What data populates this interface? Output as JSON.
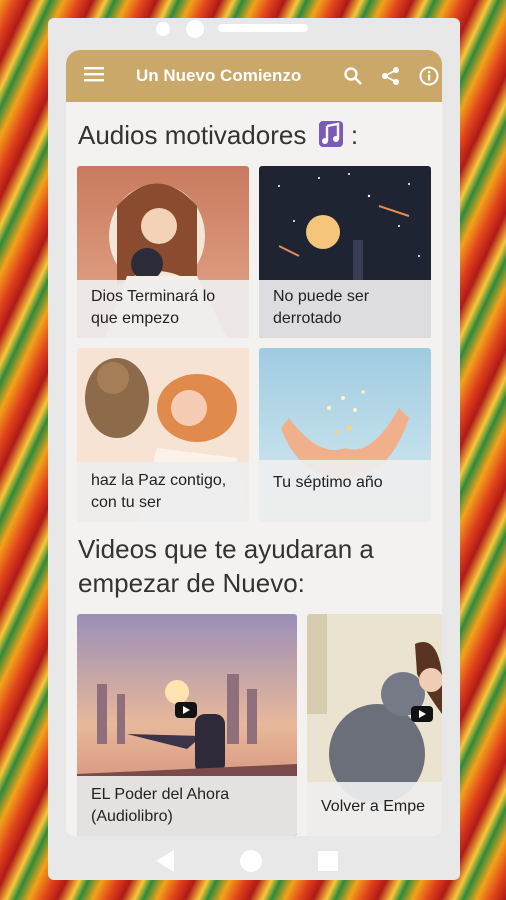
{
  "app": {
    "title": "Un Nuevo Comienzo"
  },
  "icons": {
    "menu": "menu-icon",
    "search": "search-icon",
    "share": "share-icon",
    "info": "info-icon"
  },
  "audios": {
    "heading": "Audios motivadores",
    "heading_suffix": ":",
    "items": [
      {
        "title": "Dios Terminará lo que empezo"
      },
      {
        "title": "No puede ser derrotado"
      },
      {
        "title": "haz la Paz contigo, con tu ser"
      },
      {
        "title": "Tu séptimo año"
      }
    ]
  },
  "videos": {
    "heading": "Videos que te ayudaran a empezar de Nuevo:",
    "items": [
      {
        "title": "EL Poder del Ahora (Audiolibro)"
      },
      {
        "title": "Volver a Empe"
      }
    ]
  },
  "colors": {
    "appbar": "#caa869",
    "accent": "#7b5bb5"
  }
}
